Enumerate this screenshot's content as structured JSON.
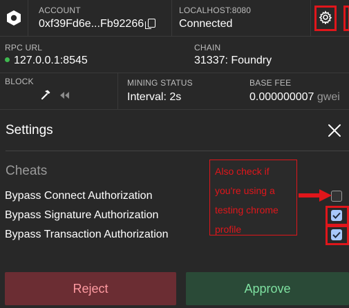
{
  "header": {
    "account_label": "ACCOUNT",
    "account_value": "0xf39Fd6e...Fb92266",
    "host_label": "LOCALHOST:8080",
    "host_value": "Connected"
  },
  "network": {
    "rpc_label": "RPC URL",
    "rpc_value": "127.0.0.1:8545",
    "chain_label": "CHAIN",
    "chain_value": "31337: Foundry"
  },
  "block": {
    "block_label": "BLOCK",
    "mining_label": "MINING STATUS",
    "mining_value": "Interval: 2s",
    "basefee_label": "BASE FEE",
    "basefee_value": "0.000000007",
    "basefee_unit": "gwei"
  },
  "settings": {
    "title": "Settings",
    "cheats_title": "Cheats",
    "options": [
      {
        "label": "Bypass Connect Authorization",
        "checked": false
      },
      {
        "label": "Bypass Signature Authorization",
        "checked": true
      },
      {
        "label": "Bypass Transaction Authorization",
        "checked": true
      }
    ]
  },
  "annotation": {
    "lines": [
      "Also check if",
      "you're using a",
      "testing chrome",
      "profile"
    ],
    "color": "#e0161b"
  },
  "actions": {
    "reject_label": "Reject",
    "approve_label": "Approve"
  },
  "icons": {
    "logo": "hexagon-logo-icon",
    "settings": "gear-icon",
    "close": "close-icon",
    "mine": "hammer-icon",
    "rewind": "rewind-icon",
    "copy": "copy-icon"
  }
}
